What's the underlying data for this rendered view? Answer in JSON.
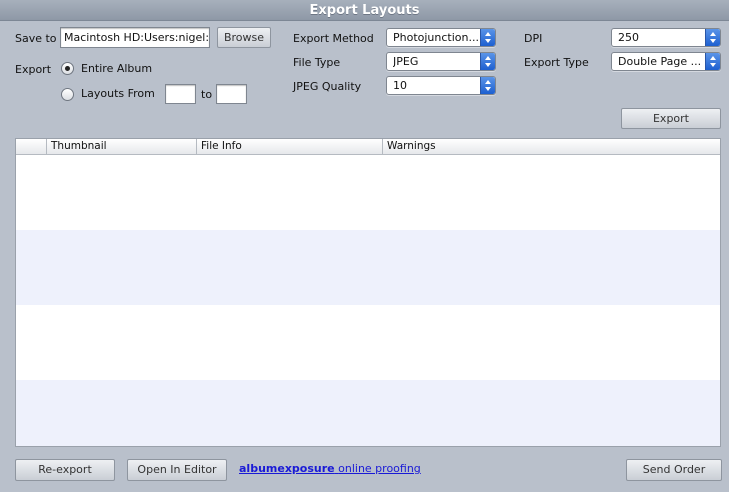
{
  "window": {
    "title": "Export Layouts"
  },
  "save_to": {
    "label": "Save to",
    "value": "Macintosh HD:Users:nigel:De",
    "browse_label": "Browse"
  },
  "export_scope": {
    "label": "Export",
    "entire_album_label": "Entire Album",
    "layouts_from_label": "Layouts From",
    "to_label": "to",
    "from_value": "",
    "to_value": "",
    "selected": "entire_album"
  },
  "export_method": {
    "label": "Export Method",
    "value": "Photojunction..."
  },
  "file_type": {
    "label": "File Type",
    "value": "JPEG"
  },
  "jpeg_quality": {
    "label": "JPEG Quality",
    "value": "10"
  },
  "dpi": {
    "label": "DPI",
    "value": "250"
  },
  "export_type": {
    "label": "Export Type",
    "value": "Double Page ..."
  },
  "export_button": {
    "label": "Export"
  },
  "table": {
    "columns": [
      "",
      "Thumbnail",
      "File Info",
      "Warnings"
    ],
    "rows": []
  },
  "footer": {
    "reexport_label": "Re-export",
    "open_in_editor_label": "Open In Editor",
    "link_brand": "albumexposure",
    "link_text": "online proofing",
    "send_order_label": "Send Order"
  },
  "colors": {
    "accent": "#1d5fd0",
    "row_alt": "#eef1fc",
    "background": "#b9c0cb",
    "link": "#1a1ad6"
  }
}
